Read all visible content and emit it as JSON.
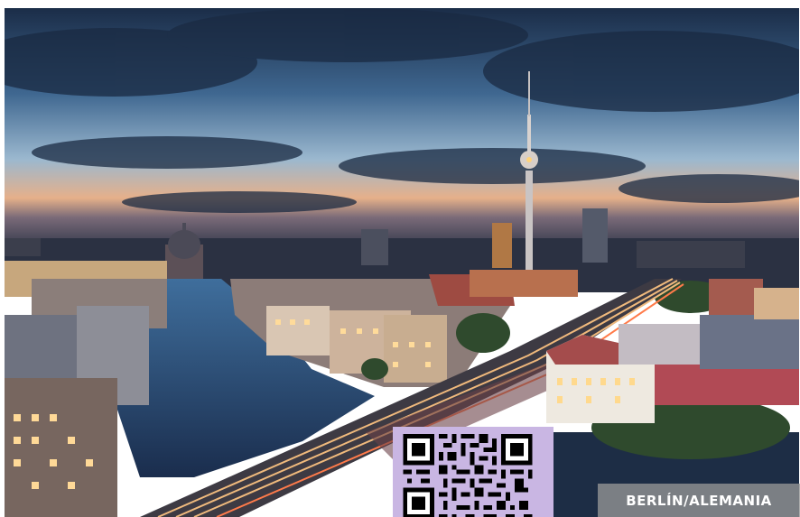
{
  "caption": {
    "text": "BERLÍN/ALEMANIA",
    "background": "#969696",
    "color": "#ffffff"
  },
  "qr_code": {
    "background": "#c9b6e3"
  },
  "scene": {
    "sky_top": "#1d3553",
    "sky_horizon": "#f3b07d",
    "river": "#233d63",
    "tower_light": "#ffd37a"
  }
}
